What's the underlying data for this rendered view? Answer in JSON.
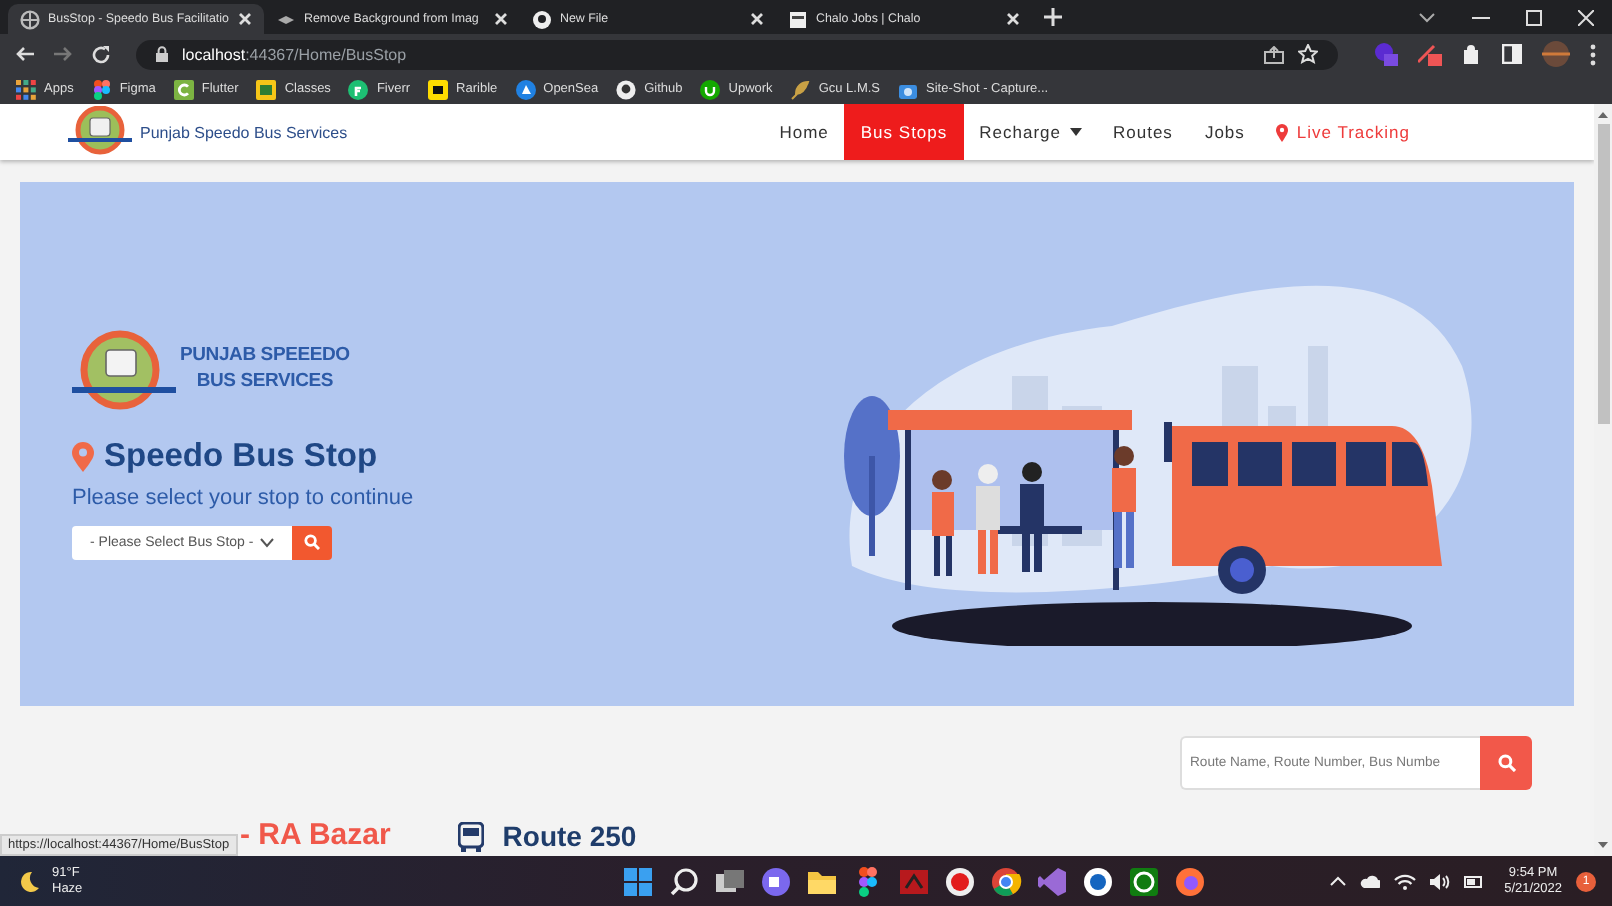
{
  "browser": {
    "tabs": [
      {
        "title": "BusStop - Speedo Bus Facilitatio",
        "kind": "globe",
        "selected": true
      },
      {
        "title": "Remove Background from Imag",
        "kind": "layers",
        "selected": false
      },
      {
        "title": "New File",
        "kind": "github",
        "selected": false
      },
      {
        "title": "Chalo Jobs | Chalo",
        "kind": "doc",
        "selected": false
      }
    ],
    "url_host": "localhost",
    "url_path": ":44367/Home/BusStop",
    "bookmarks": [
      {
        "label": "Apps",
        "kind": "apps"
      },
      {
        "label": "Figma",
        "kind": "figma"
      },
      {
        "label": "Flutter",
        "kind": "green"
      },
      {
        "label": "Classes",
        "kind": "yellow"
      },
      {
        "label": "Fiverr",
        "kind": "fiverr"
      },
      {
        "label": "Rarible",
        "kind": "rarible"
      },
      {
        "label": "OpenSea",
        "kind": "opensea"
      },
      {
        "label": "Github",
        "kind": "github"
      },
      {
        "label": "Upwork",
        "kind": "upwork"
      },
      {
        "label": "Gcu L.M.S",
        "kind": "gcu"
      },
      {
        "label": "Site-Shot - Capture...",
        "kind": "camera"
      }
    ],
    "status_url": "https://localhost:44367/Home/BusStop"
  },
  "navbar": {
    "brand": "Punjab Speedo Bus Services",
    "items": [
      {
        "label": "Home",
        "kind": "link",
        "selected": false
      },
      {
        "label": "Bus Stops",
        "kind": "link",
        "selected": true
      },
      {
        "label": "Recharge",
        "kind": "dropdown",
        "selected": false
      },
      {
        "label": "Routes",
        "kind": "link",
        "selected": false
      },
      {
        "label": "Jobs",
        "kind": "link",
        "selected": false
      },
      {
        "label": "Live Tracking",
        "kind": "live",
        "selected": false
      }
    ]
  },
  "hero": {
    "logo_line1": "PUNJAB SPEEEDO",
    "logo_line2": "BUS SERVICES",
    "title": "Speedo Bus Stop",
    "subtitle": "Please select your stop to continue",
    "select_value": "- Please Select Bus Stop -"
  },
  "route_search": {
    "placeholder": "Route Name, Route Number, Bus Numbe"
  },
  "route": {
    "stops": "- RA Bazar",
    "name": "Route 250"
  },
  "taskbar": {
    "temperature": "91°F",
    "weather": "Haze",
    "time": "9:54 PM",
    "date": "5/21/2022",
    "notifications": "1"
  }
}
